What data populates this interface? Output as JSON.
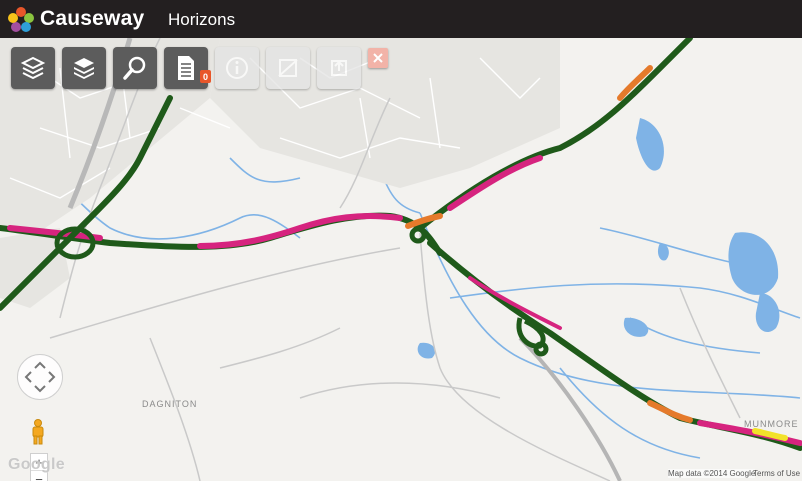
{
  "header": {
    "brand_name": "Causeway",
    "brand_sub": "Horizons",
    "logo_colors": [
      "#e8562a",
      "#8bc43f",
      "#2f9fd8",
      "#a34fa0",
      "#f7c21a"
    ]
  },
  "toolbar": {
    "tools": [
      {
        "name": "layers-icon",
        "state": "enabled"
      },
      {
        "name": "layers-stack-icon",
        "state": "enabled"
      },
      {
        "name": "search-icon",
        "state": "enabled"
      },
      {
        "name": "document-icon",
        "state": "enabled",
        "badge": "0"
      },
      {
        "name": "info-icon",
        "state": "disabled"
      },
      {
        "name": "measure-icon",
        "state": "disabled"
      },
      {
        "name": "export-icon",
        "state": "disabled"
      },
      {
        "name": "close-icon",
        "state": "disabled"
      }
    ]
  },
  "map": {
    "place_labels": [
      "DAGNITON",
      "MUNMORE"
    ],
    "provider_logo": "Google",
    "attribution": "Map data ©2014 Google",
    "terms": "Terms of Use",
    "zoom_in": "+",
    "zoom_out": "−",
    "route_colors": {
      "good": "#1f5a1a",
      "warning": "#d6247f",
      "moderate": "#e57a2b",
      "minor": "#f2e22a"
    }
  }
}
